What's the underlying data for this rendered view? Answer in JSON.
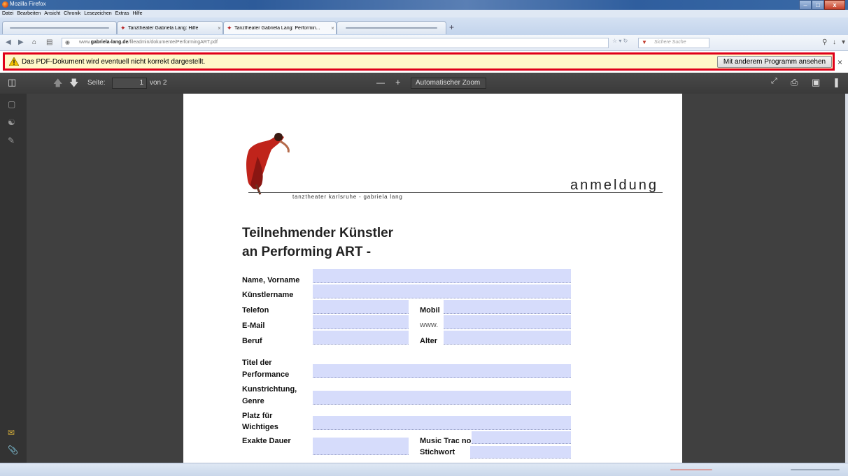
{
  "window": {
    "title": "Mozilla Firefox",
    "min": "–",
    "max": "□",
    "close": "x"
  },
  "menu": [
    "Datei",
    "Bearbeiten",
    "Ansicht",
    "Chronik",
    "Lesezeichen",
    "Extras",
    "Hilfe"
  ],
  "tabs": [
    {
      "label": "Tanztheater Gabriela Lang: Hilfe",
      "close": "×"
    },
    {
      "label": "Tanztheater Gabriela Lang: Performin...",
      "close": "×"
    }
  ],
  "newtab": "+",
  "nav": {
    "url_prefix": "www.",
    "url_domain": "gabriela-lang.de",
    "url_path": "/fileadmin/dokumente/PerformingART.pdf",
    "search_placeholder": "Sichere Suche"
  },
  "notification": {
    "message": "Das PDF-Dokument wird eventuell nicht korrekt dargestellt.",
    "button": "Mit anderem Programm ansehen",
    "close": "×"
  },
  "pdf_toolbar": {
    "page_label": "Seite:",
    "page_value": "1",
    "page_total": "von 2",
    "zoom_minus": "—",
    "zoom_plus": "+",
    "zoom_value": "Automatischer Zoom"
  },
  "document": {
    "header": "anmeldung",
    "subheader": "tanztheater karlsruhe - gabriela lang",
    "title_line1": "Teilnehmender Künstler",
    "title_line2": "an  Performing ART -",
    "labels": {
      "name": "Name, Vorname",
      "kuenstlername": "Künstlername",
      "telefon": "Telefon",
      "mobil": "Mobil",
      "email": "E-Mail",
      "www": "www.",
      "beruf": "Beruf",
      "alter": "Alter",
      "titel_1": "Titel der",
      "titel_2": "Performance",
      "kunst_1": "Kunstrichtung,",
      "kunst_2": "Genre",
      "platz_1": "Platz für",
      "platz_2": "Wichtiges",
      "dauer": "Exakte Dauer",
      "music": "Music Trac no",
      "stichwort": "Stichwort"
    }
  }
}
